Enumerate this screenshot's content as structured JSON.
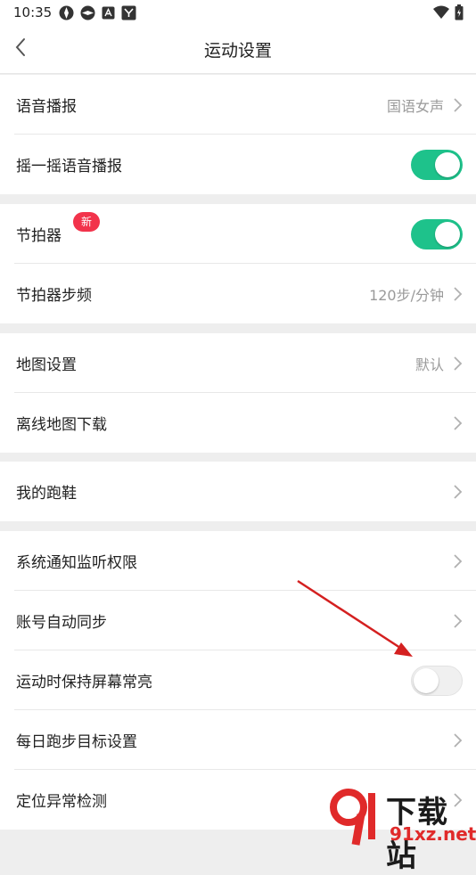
{
  "status_bar": {
    "time": "10:35"
  },
  "header": {
    "title": "运动设置"
  },
  "groups": [
    {
      "rows": [
        {
          "label": "语音播报",
          "value": "国语女声"
        },
        {
          "label": "摇一摇语音播报",
          "toggle": "on"
        }
      ]
    },
    {
      "rows": [
        {
          "label": "节拍器",
          "badge": "新",
          "toggle": "on"
        },
        {
          "label": "节拍器步频",
          "value": "120步/分钟"
        }
      ]
    },
    {
      "rows": [
        {
          "label": "地图设置",
          "value": "默认"
        },
        {
          "label": "离线地图下载"
        }
      ]
    },
    {
      "rows": [
        {
          "label": "我的跑鞋"
        }
      ]
    },
    {
      "rows": [
        {
          "label": "系统通知监听权限"
        },
        {
          "label": "账号自动同步"
        },
        {
          "label": "运动时保持屏幕常亮",
          "toggle": "off"
        },
        {
          "label": "每日跑步目标设置"
        },
        {
          "label": "定位异常检测"
        }
      ]
    }
  ],
  "watermark": {
    "line1": "下载站",
    "line2": "91xz.net"
  },
  "colors": {
    "accent_green": "#1ec28b",
    "badge_red": "#f2334b",
    "annotation_arrow": "#d42020"
  }
}
